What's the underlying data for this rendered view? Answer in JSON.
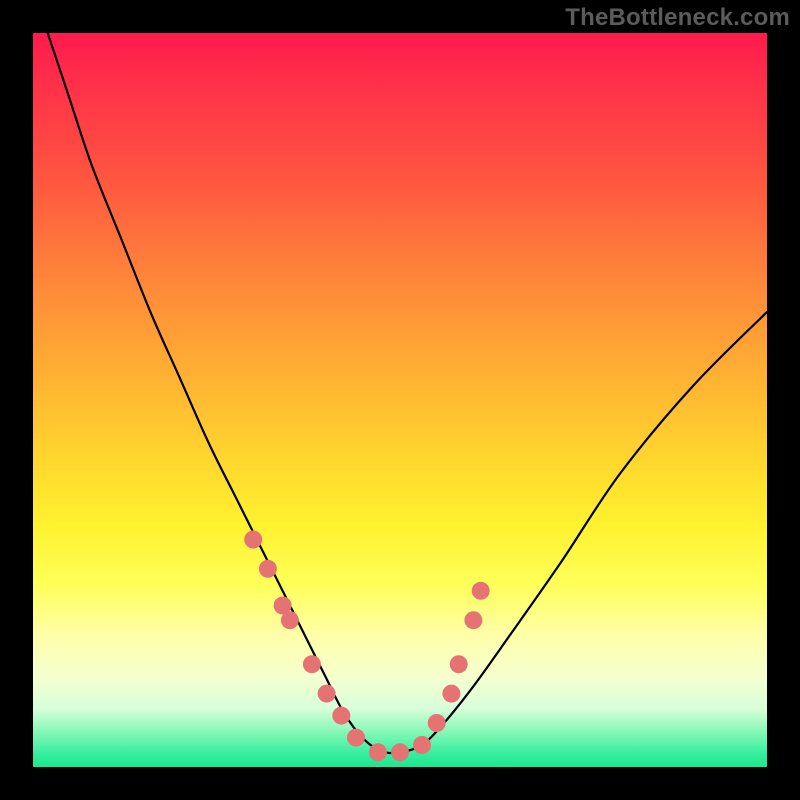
{
  "watermark": "TheBottleneck.com",
  "chart_data": {
    "type": "line",
    "title": "",
    "xlabel": "",
    "ylabel": "",
    "xlim": [
      0,
      100
    ],
    "ylim": [
      0,
      100
    ],
    "series": [
      {
        "name": "bottleneck-curve",
        "x": [
          2,
          5,
          8,
          12,
          16,
          20,
          24,
          28,
          31,
          34,
          37,
          40,
          42,
          44,
          46,
          48,
          50,
          53,
          56,
          60,
          65,
          72,
          80,
          90,
          100
        ],
        "y": [
          100,
          91,
          82,
          72,
          62,
          53,
          44,
          36,
          30,
          24,
          18,
          12,
          8,
          5,
          3,
          2,
          2,
          3,
          6,
          11,
          18,
          28,
          40,
          52,
          62
        ]
      }
    ],
    "markers": {
      "name": "highlight-points",
      "color": "#e57373",
      "x": [
        30,
        32,
        34,
        35,
        38,
        40,
        42,
        44,
        47,
        50,
        53,
        55,
        57,
        58,
        60,
        61
      ],
      "y": [
        31,
        27,
        22,
        20,
        14,
        10,
        7,
        4,
        2,
        2,
        3,
        6,
        10,
        14,
        20,
        24
      ]
    }
  }
}
